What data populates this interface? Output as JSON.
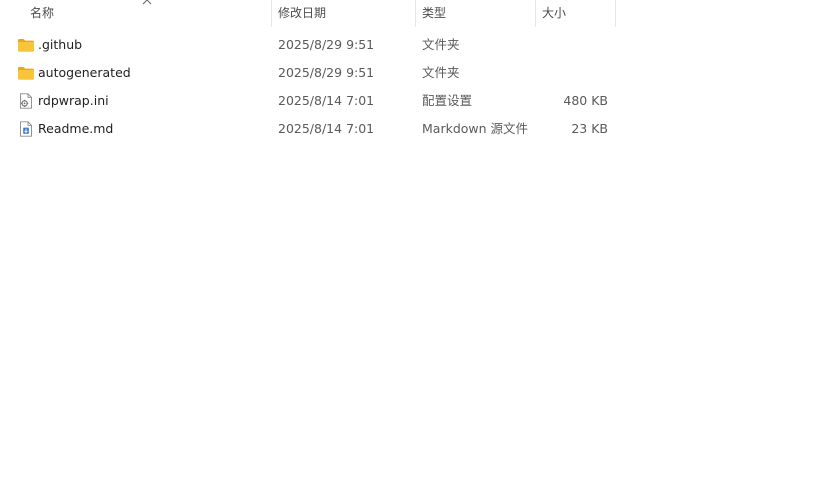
{
  "columns": {
    "name": "名称",
    "date": "修改日期",
    "type": "类型",
    "size": "大小"
  },
  "files": [
    {
      "name": ".github",
      "date": "2025/8/29 9:51",
      "type": "文件夹",
      "size": "",
      "icon": "folder-icon"
    },
    {
      "name": "autogenerated",
      "date": "2025/8/29 9:51",
      "type": "文件夹",
      "size": "",
      "icon": "folder-icon"
    },
    {
      "name": "rdpwrap.ini",
      "date": "2025/8/14 7:01",
      "type": "配置设置",
      "size": "480 KB",
      "icon": "settings-file-icon"
    },
    {
      "name": "Readme.md",
      "date": "2025/8/14 7:01",
      "type": "Markdown 源文件",
      "size": "23 KB",
      "icon": "markdown-file-icon"
    }
  ],
  "colors": {
    "folder": "#f8c53a",
    "folder_dark": "#e6a823",
    "header_text": "#4c4c4c",
    "divider": "#e5e5e5"
  }
}
